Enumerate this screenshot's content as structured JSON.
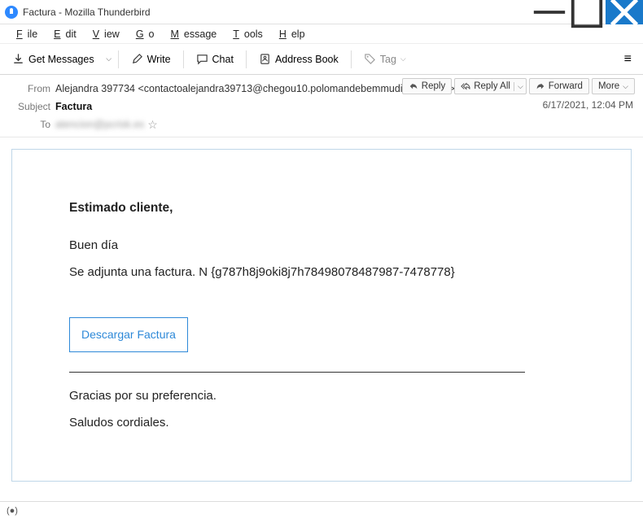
{
  "window": {
    "title": "Factura - Mozilla Thunderbird"
  },
  "menu": {
    "file": "File",
    "edit": "Edit",
    "view": "View",
    "go": "Go",
    "message": "Message",
    "tools": "Tools",
    "help": "Help"
  },
  "toolbar": {
    "getmsg": "Get Messages",
    "write": "Write",
    "chat": "Chat",
    "address": "Address Book",
    "tag": "Tag"
  },
  "header": {
    "from_label": "From",
    "from_value": "Alejandra 397734 <contactoalejandra39713@chegou10.polomandebemmudial.com.mx>",
    "subject_label": "Subject",
    "subject_value": "Factura",
    "to_label": "To",
    "to_value": "atencion@pcrisk.es",
    "datetime": "6/17/2021, 12:04 PM"
  },
  "actions": {
    "reply": "Reply",
    "replyall": "Reply All",
    "forward": "Forward",
    "more": "More"
  },
  "body": {
    "greeting": "Estimado cliente,",
    "line1": "Buen día",
    "line2": "Se adjunta una factura. N {g787h8j9oki8j7h78498078487987-7478778}",
    "download_btn": "Descargar Factura",
    "thanks": "Gracias por su preferencia.",
    "closing": "Saludos cordiales."
  },
  "status": {
    "icon": "(●)"
  }
}
